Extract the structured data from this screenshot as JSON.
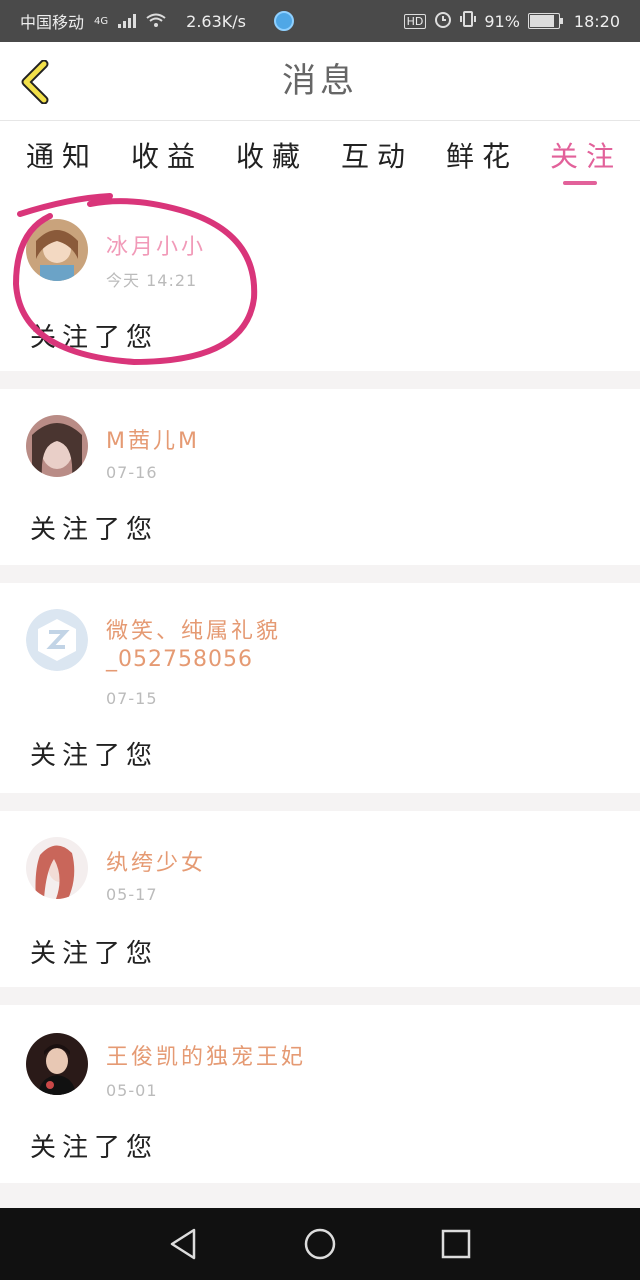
{
  "status_bar": {
    "carrier": "中国移动",
    "network": "4G",
    "speed": "2.63K/s",
    "hd": "HD",
    "battery": "91%",
    "battery_level": 0.91,
    "time": "18:20"
  },
  "header": {
    "title": "消息"
  },
  "tabs": [
    {
      "label": "通知"
    },
    {
      "label": "收益"
    },
    {
      "label": "收藏"
    },
    {
      "label": "互动"
    },
    {
      "label": "鲜花"
    },
    {
      "label": "关注",
      "active": true
    }
  ],
  "notifications": [
    {
      "name": "冰月小小",
      "time": "今天 14:21",
      "message": "关注了您"
    },
    {
      "name": "M茜儿M",
      "time": "07-16",
      "message": "关注了您"
    },
    {
      "name": "微笑、纯属礼貌",
      "name_line2": "_052758056",
      "time": "07-15",
      "message": "关注了您"
    },
    {
      "name": "纨绔少女",
      "time": "05-17",
      "message": "关注了您"
    },
    {
      "name": "王俊凯的独宠王妃",
      "time": "05-01",
      "message": "关注了您"
    }
  ],
  "colors": {
    "accent": "#e2619a",
    "name": "#e59a73",
    "annotation": "#d9357a"
  }
}
